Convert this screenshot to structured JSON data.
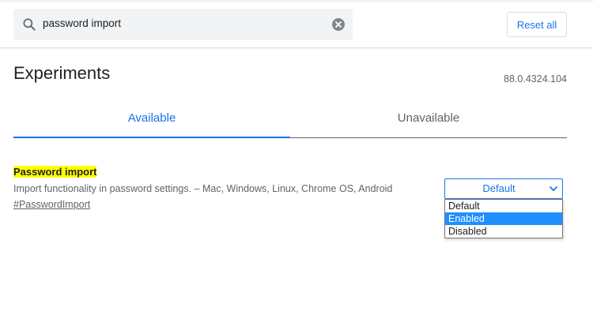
{
  "header": {
    "search": {
      "value": "password import",
      "icon": "search-icon",
      "clear_icon": "clear-icon"
    },
    "reset_label": "Reset all"
  },
  "page": {
    "title": "Experiments",
    "version": "88.0.4324.104"
  },
  "tabs": [
    {
      "label": "Available",
      "active": true
    },
    {
      "label": "Unavailable",
      "active": false
    }
  ],
  "experiment": {
    "name": "Password import",
    "description": "Import functionality in password settings. – Mac, Windows, Linux, Chrome OS, Android",
    "link": "#PasswordImport",
    "select": {
      "value": "Default",
      "options": [
        "Default",
        "Enabled",
        "Disabled"
      ],
      "highlighted": "Enabled"
    }
  },
  "colors": {
    "accent": "#1a73e8",
    "highlight": "#ffff00",
    "option_selected": "#1e90ff",
    "search_bg": "#f1f3f4"
  }
}
